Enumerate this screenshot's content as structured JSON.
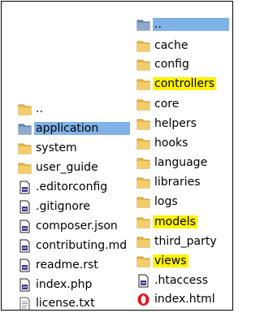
{
  "left": {
    "items": [
      {
        "label": "..",
        "icon": "folder-icon",
        "selected": false
      },
      {
        "label": "application",
        "icon": "folder-icon",
        "selected": true
      },
      {
        "label": "system",
        "icon": "folder-icon",
        "selected": false
      },
      {
        "label": "user_guide",
        "icon": "folder-icon",
        "selected": false
      },
      {
        "label": ".editorconfig",
        "icon": "file-icon",
        "selected": false
      },
      {
        "label": ".gitignore",
        "icon": "file-icon",
        "selected": false
      },
      {
        "label": "composer.json",
        "icon": "file-icon",
        "selected": false
      },
      {
        "label": "contributing.md",
        "icon": "file-icon",
        "selected": false
      },
      {
        "label": "readme.rst",
        "icon": "file-icon",
        "selected": false
      },
      {
        "label": "index.php",
        "icon": "file-icon",
        "selected": false
      },
      {
        "label": "license.txt",
        "icon": "text-file-icon",
        "selected": false
      }
    ]
  },
  "right": {
    "items": [
      {
        "label": "..",
        "icon": "folder-icon",
        "selected": true
      },
      {
        "label": "cache",
        "icon": "folder-icon"
      },
      {
        "label": "config",
        "icon": "folder-icon"
      },
      {
        "label": "controllers",
        "icon": "folder-icon",
        "highlighted": true
      },
      {
        "label": "core",
        "icon": "folder-icon"
      },
      {
        "label": "helpers",
        "icon": "folder-icon"
      },
      {
        "label": "hooks",
        "icon": "folder-icon"
      },
      {
        "label": "language",
        "icon": "folder-icon"
      },
      {
        "label": "libraries",
        "icon": "folder-icon"
      },
      {
        "label": "logs",
        "icon": "folder-icon"
      },
      {
        "label": "models",
        "icon": "folder-icon",
        "highlighted": true
      },
      {
        "label": "third_party",
        "icon": "folder-icon"
      },
      {
        "label": "views",
        "icon": "folder-icon",
        "highlighted": true
      },
      {
        "label": ".htaccess",
        "icon": "file-icon"
      },
      {
        "label": "index.html",
        "icon": "opera-icon"
      }
    ]
  },
  "colors": {
    "selection": "#7fb2e6",
    "highlight": "#fff200",
    "folder": "#e8b94a",
    "folder_dark": "#c8952a"
  }
}
